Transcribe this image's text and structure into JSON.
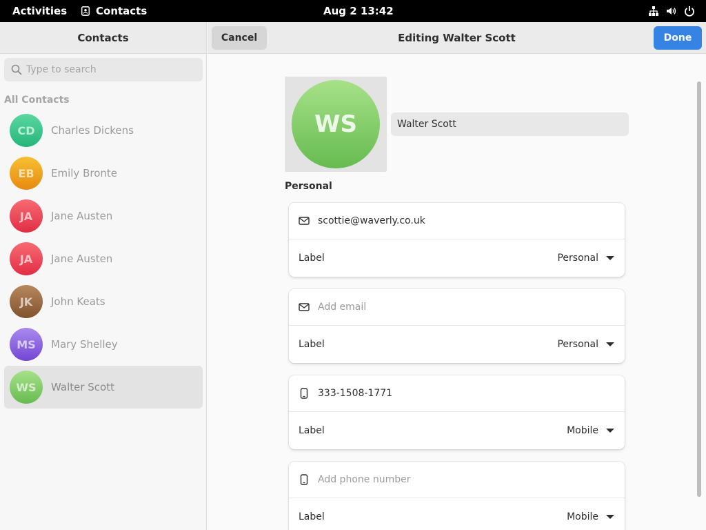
{
  "topbar": {
    "activities": "Activities",
    "app_name": "Contacts",
    "clock": "Aug 2  13:42",
    "icons": [
      "network-icon",
      "volume-icon",
      "power-icon"
    ]
  },
  "sidebar": {
    "title": "Contacts",
    "search_placeholder": "Type to search",
    "section_label": "All Contacts",
    "contacts": [
      {
        "initials": "CD",
        "name": "Charles Dickens",
        "color": "#3ec88a"
      },
      {
        "initials": "EB",
        "name": "Emily Bronte",
        "color": "#f0a01a"
      },
      {
        "initials": "JA",
        "name": "Jane Austen",
        "color": "#ee4a58"
      },
      {
        "initials": "JA",
        "name": "Jane Austen",
        "color": "#ee4a58"
      },
      {
        "initials": "JK",
        "name": "John Keats",
        "color": "#9a6a48"
      },
      {
        "initials": "MS",
        "name": "Mary Shelley",
        "color": "#8a62d8"
      },
      {
        "initials": "WS",
        "name": "Walter Scott",
        "color": "#7acc5a",
        "selected": true
      }
    ]
  },
  "header": {
    "cancel_label": "Cancel",
    "title": "Editing Walter Scott",
    "done_label": "Done"
  },
  "editor": {
    "avatar_initials": "WS",
    "name_value": "Walter Scott",
    "group_title": "Personal",
    "fields": [
      {
        "icon": "mail-icon",
        "value": "scottie@waverly.co.uk",
        "placeholder": "",
        "label": "Label",
        "type": "Personal"
      },
      {
        "icon": "mail-icon",
        "value": "",
        "placeholder": "Add email",
        "label": "Label",
        "type": "Personal"
      },
      {
        "icon": "phone-icon",
        "value": "333-1508-1771",
        "placeholder": "",
        "label": "Label",
        "type": "Mobile"
      },
      {
        "icon": "phone-icon",
        "value": "",
        "placeholder": "Add phone number",
        "label": "Label",
        "type": "Mobile"
      }
    ]
  },
  "colors": {
    "accent": "#3584e4",
    "topbar": "#000000"
  }
}
